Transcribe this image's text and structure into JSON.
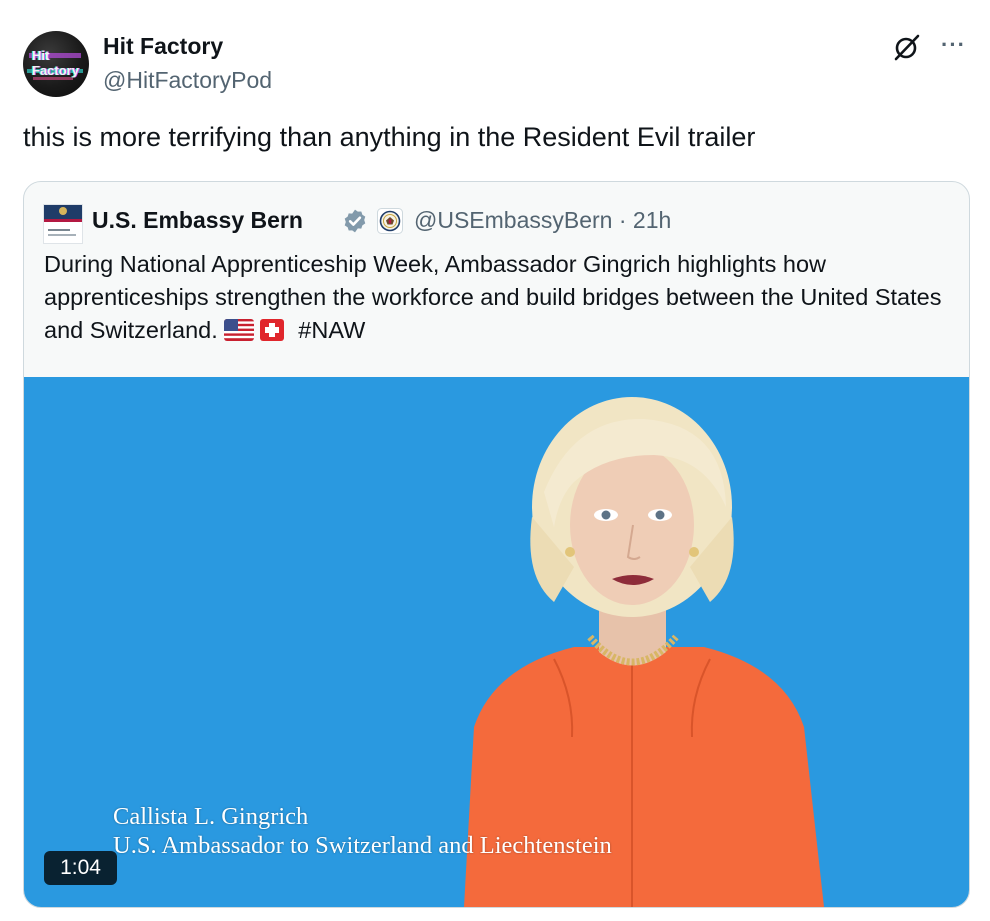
{
  "post": {
    "author_name": "Hit Factory",
    "author_handle": "@HitFactoryPod",
    "avatar_text_line1": "Hit",
    "avatar_text_line2": "Factory",
    "text": "this is more terrifying than anything in the Resident Evil trailer"
  },
  "quoted": {
    "author_name": "U.S. Embassy Bern",
    "handle_time": "@USEmbassyBern · 21h",
    "body": "During National Apprenticeship Week, Ambassador Gingrich highlights how apprenticeships strengthen the workforce and build bridges between the United States and Switzerland.",
    "hashtag": "#NAW",
    "video": {
      "caption_line1": "Callista L. Gingrich",
      "caption_line2": "U.S. Ambassador to Switzerland and Liechtenstein",
      "duration": "1:04"
    }
  },
  "icons": {
    "more": "···",
    "grok": "grok-icon",
    "verified": "verified-badge-icon",
    "government": "government-seal-icon"
  },
  "colors": {
    "verified": "#829aab",
    "video_background": "#2a99e0",
    "secondary_text": "#536471"
  }
}
